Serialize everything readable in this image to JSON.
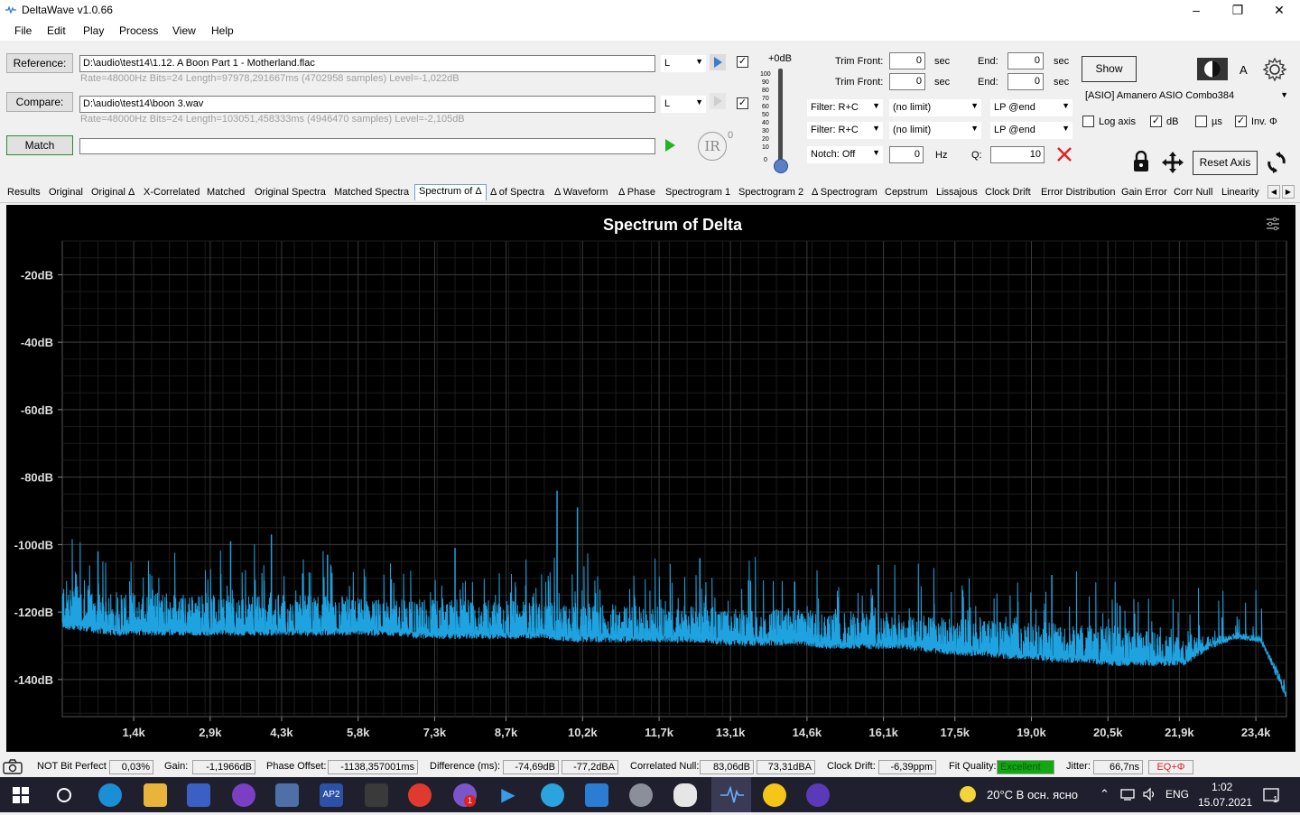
{
  "window": {
    "title": "DeltaWave v1.0.66"
  },
  "menu": [
    "File",
    "Edit",
    "Play",
    "Process",
    "View",
    "Help"
  ],
  "reference": {
    "button": "Reference:",
    "path": "D:\\audio\\test14\\1.12. A Boon Part 1 - Motherland.flac",
    "info": "Rate=48000Hz Bits=24 Length=97978,291667ms (4702958 samples) Level=-1,022dB",
    "channel": "L"
  },
  "compare": {
    "button": "Compare:",
    "path": "D:\\audio\\test14\\boon 3.wav",
    "info": "Rate=48000Hz Bits=24 Length=103051,458333ms (4946470 samples) Level=-2,105dB",
    "channel": "L"
  },
  "match": {
    "button": "Match",
    "ir_label": "IR",
    "ir_sup": "0"
  },
  "volume": {
    "top_label": "+0dB",
    "ticks": [
      "100",
      "90",
      "80",
      "70",
      "60",
      "50",
      "40",
      "30",
      "20",
      "10",
      "0"
    ],
    "level": 0.0
  },
  "trim": {
    "front_label": "Trim Front:",
    "end_label": "End:",
    "unit": "sec",
    "front1": "0",
    "end1": "0",
    "front2": "0",
    "end2": "0"
  },
  "filters": {
    "filter_label": "Filter: R+C",
    "limit": "(no limit)",
    "lp": "LP @end",
    "notch": "Notch: Off",
    "notch_hz": "0",
    "hz_unit": "Hz",
    "q_label": "Q:",
    "q_value": "10"
  },
  "right_panel": {
    "show": "Show",
    "a_label": "A",
    "device": "[ASIO] Amanero ASIO Combo384",
    "log_axis": "Log axis",
    "db": "dB",
    "us": "µs",
    "inv": "Inv. Φ",
    "db_checked": "✓",
    "inv_checked": "✓",
    "reset_axis": "Reset Axis"
  },
  "tabs": [
    "Results",
    "Original",
    "Original Δ",
    "X-Correlated",
    "Matched",
    "Original Spectra",
    "Matched Spectra",
    "Spectrum of Δ",
    "Δ of Spectra",
    "Δ Waveform",
    "Δ Phase",
    "Spectrogram 1",
    "Spectrogram 2",
    "Δ Spectrogram",
    "Cepstrum",
    "Lissajous",
    "Clock Drift",
    "Error Distribution",
    "Gain Error",
    "Corr Null",
    "Linearity"
  ],
  "chart_data": {
    "type": "line",
    "title": "Spectrum of Delta",
    "y_tick_labels": [
      "-20dB",
      "-40dB",
      "-60dB",
      "-80dB",
      "-100dB",
      "-120dB",
      "-140dB"
    ],
    "y_ticks": [
      -20,
      -40,
      -60,
      -80,
      -100,
      -120,
      -140
    ],
    "x_tick_labels": [
      "1,4k",
      "2,9k",
      "4,3k",
      "5,8k",
      "7,3k",
      "8,7k",
      "10,2k",
      "11,7k",
      "13,1k",
      "14,6k",
      "16,1k",
      "17,5k",
      "19,0k",
      "20,5k",
      "21,9k",
      "23,4k"
    ],
    "x_ticks": [
      1400,
      2900,
      4300,
      5800,
      7300,
      8700,
      10200,
      11700,
      13100,
      14600,
      16100,
      17500,
      19000,
      20500,
      21900,
      23400
    ],
    "xlim": [
      0,
      24000
    ],
    "ylim": [
      -151,
      -10
    ],
    "grid": true,
    "color": "#1fa3e0",
    "series": [
      {
        "x": [
          0,
          500,
          1000,
          1500,
          2000,
          2500,
          3000,
          3500,
          4000,
          4500,
          5000,
          5500,
          6000,
          6500,
          7000,
          7500,
          8000,
          8500,
          9000,
          9500,
          10000,
          10500,
          11000,
          11500,
          12000,
          12500,
          13000,
          13500,
          14000,
          14500,
          15000,
          15500,
          16000,
          16500,
          17000,
          17500,
          18000,
          18500,
          19000,
          19500,
          20000,
          20500,
          21000,
          21500,
          22000,
          22500,
          23000,
          23500,
          24000
        ],
        "floor": [
          -125,
          -126,
          -127,
          -127,
          -127,
          -127,
          -127,
          -127,
          -127,
          -127,
          -127,
          -127,
          -127,
          -127,
          -128,
          -128,
          -128,
          -128,
          -128,
          -128,
          -129,
          -129,
          -129,
          -129,
          -129,
          -129,
          -130,
          -130,
          -130,
          -130,
          -131,
          -131,
          -131,
          -131,
          -132,
          -133,
          -133,
          -134,
          -134,
          -135,
          -135,
          -136,
          -136,
          -136,
          -136,
          -131,
          -128,
          -129,
          -146
        ],
        "top": [
          -110,
          -112,
          -113,
          -114,
          -114,
          -114,
          -115,
          -115,
          -115,
          -115,
          -115,
          -115,
          -116,
          -116,
          -116,
          -116,
          -116,
          -116,
          -117,
          -117,
          -117,
          -117,
          -118,
          -118,
          -118,
          -118,
          -119,
          -119,
          -119,
          -119,
          -120,
          -120,
          -120,
          -121,
          -121,
          -122,
          -122,
          -123,
          -123,
          -123,
          -124,
          -124,
          -125,
          -126,
          -126,
          -127,
          -126,
          -128,
          -141
        ]
      }
    ],
    "peaks": [
      [
        700,
        -102
      ],
      [
        3300,
        -99
      ],
      [
        4100,
        -97
      ],
      [
        5200,
        -103
      ],
      [
        7700,
        -101
      ],
      [
        9700,
        -84
      ],
      [
        10100,
        -89
      ],
      [
        12500,
        -104
      ],
      [
        16000,
        -106
      ],
      [
        19400,
        -109
      ]
    ]
  },
  "status": {
    "bit_perfect": "NOT Bit Perfect",
    "bit_perfect_val": "0,03%",
    "gain_label": "Gain:",
    "gain": "-1,1966dB",
    "phase_label": "Phase Offset:",
    "phase": "-1138,357001ms",
    "diff_label": "Difference (ms):",
    "diff1": "-74,69dB",
    "diff2": "-77,2dBA",
    "corr_label": "Correlated Null:",
    "corr1": "83,06dB",
    "corr2": "73,31dBA",
    "drift_label": "Clock Drift:",
    "drift": "-6,39ppm",
    "fit_label": "Fit Quality:",
    "fit": "Excellent",
    "jitter_label": "Jitter:",
    "jitter": "66,7ns",
    "eq": "EQ+Φ"
  },
  "taskbar": {
    "weather": "20°C  В осн. ясно",
    "lang": "ENG",
    "time": "1:02",
    "date": "15.07.2021",
    "badge": "1",
    "notif": "1"
  }
}
